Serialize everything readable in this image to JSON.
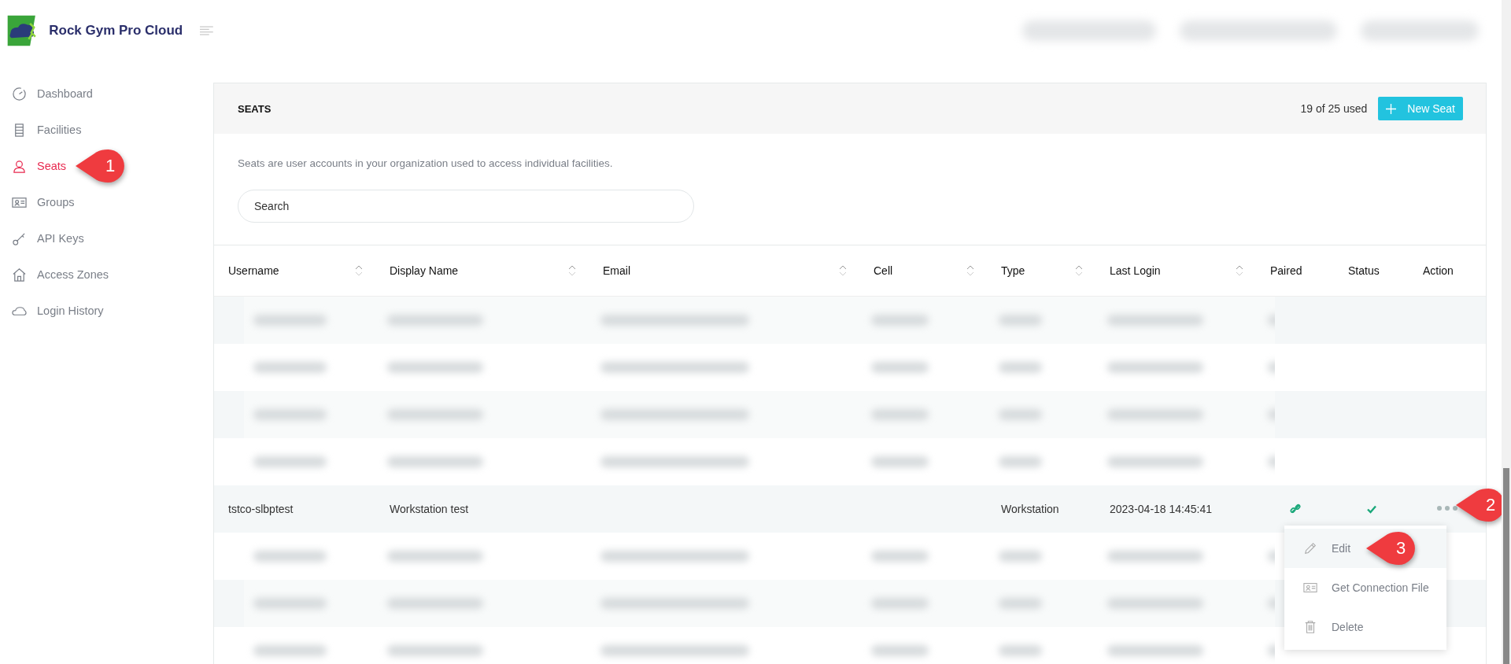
{
  "brand": {
    "name": "Rock Gym Pro Cloud"
  },
  "sidebar": {
    "items": [
      {
        "label": "Dashboard",
        "selected": false
      },
      {
        "label": "Facilities",
        "selected": false
      },
      {
        "label": "Seats",
        "selected": true,
        "callout": "1"
      },
      {
        "label": "Groups",
        "selected": false
      },
      {
        "label": "API Keys",
        "selected": false
      },
      {
        "label": "Access Zones",
        "selected": false
      },
      {
        "label": "Login History",
        "selected": false
      }
    ]
  },
  "card": {
    "title": "SEATS",
    "usage": "19 of 25 used",
    "new_button": "New Seat",
    "description": "Seats are user accounts in your organization used to access individual facilities.",
    "search": {
      "placeholder": "Search"
    }
  },
  "table": {
    "columns": [
      {
        "label": "Username",
        "sortable": true
      },
      {
        "label": "Display Name",
        "sortable": true
      },
      {
        "label": "Email",
        "sortable": true
      },
      {
        "label": "Cell",
        "sortable": true
      },
      {
        "label": "Type",
        "sortable": true
      },
      {
        "label": "Last Login",
        "sortable": true
      },
      {
        "label": "Paired",
        "sortable": false
      },
      {
        "label": "Status",
        "sortable": false
      },
      {
        "label": "Action",
        "sortable": false
      }
    ],
    "rows": [
      {
        "kind": "redacted"
      },
      {
        "kind": "redacted"
      },
      {
        "kind": "redacted"
      },
      {
        "kind": "redacted"
      },
      {
        "kind": "data",
        "username": "tstco-slbptest",
        "display_name": "Workstation test",
        "type": "Workstation",
        "last_login": "2023-04-18 14:45:41",
        "paired": true,
        "active": true,
        "action_callout": "2",
        "menu_open": true
      },
      {
        "kind": "redacted"
      },
      {
        "kind": "redacted"
      },
      {
        "kind": "redacted"
      }
    ]
  },
  "action_menu": {
    "items": [
      {
        "label": "Edit",
        "selected": true,
        "callout": "3"
      },
      {
        "label": "Get Connection File",
        "selected": false
      },
      {
        "label": "Delete",
        "selected": false
      }
    ]
  }
}
